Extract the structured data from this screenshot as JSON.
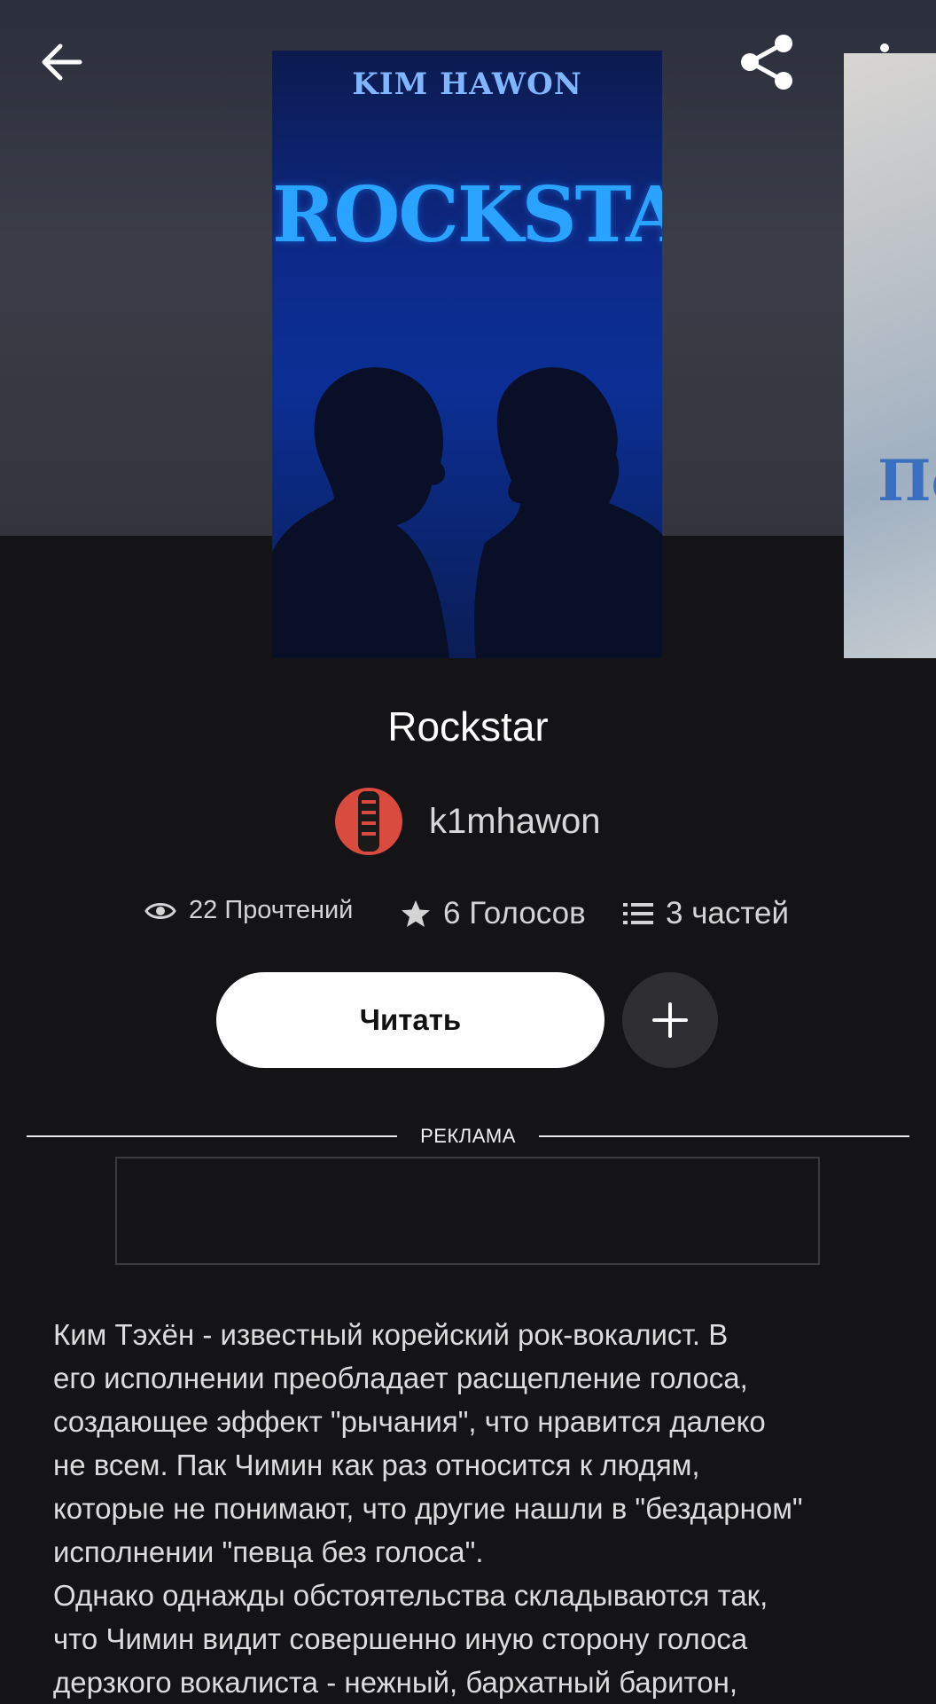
{
  "book": {
    "title": "Rockstar",
    "cover": {
      "author_text": "KIM HAWON",
      "title_text": "ROCKSTAR"
    },
    "next_cover_text": "Пе"
  },
  "author": {
    "name": "k1mhawon"
  },
  "stats": {
    "reads": "22 Прочтений",
    "votes": "6 Голосов",
    "parts": "3 частей"
  },
  "actions": {
    "read_label": "Читать",
    "add_label": "+"
  },
  "ad": {
    "label": "РЕКЛАМА"
  },
  "description": "Ким Тэхён - известный корейский рок-вокалист. В\nего исполнении преобладает расщепление голоса,\nсоздающее эффект \"рычания\", что нравится далеко\nне всем. Пак Чимин как раз относится к людям,\nкоторые не понимают, что другие нашли в \"бездарном\"\nисполнении \"певца без голоса\".\nОднако однажды обстоятельства складываются так,\nчто Чимин видит совершенно иную сторону голоса\nдерзкого вокалиста - нежный, бархатный баритон,",
  "colors": {
    "background": "#141316",
    "accent_button": "#ffffff",
    "cover_title": "#2aa2ff"
  }
}
